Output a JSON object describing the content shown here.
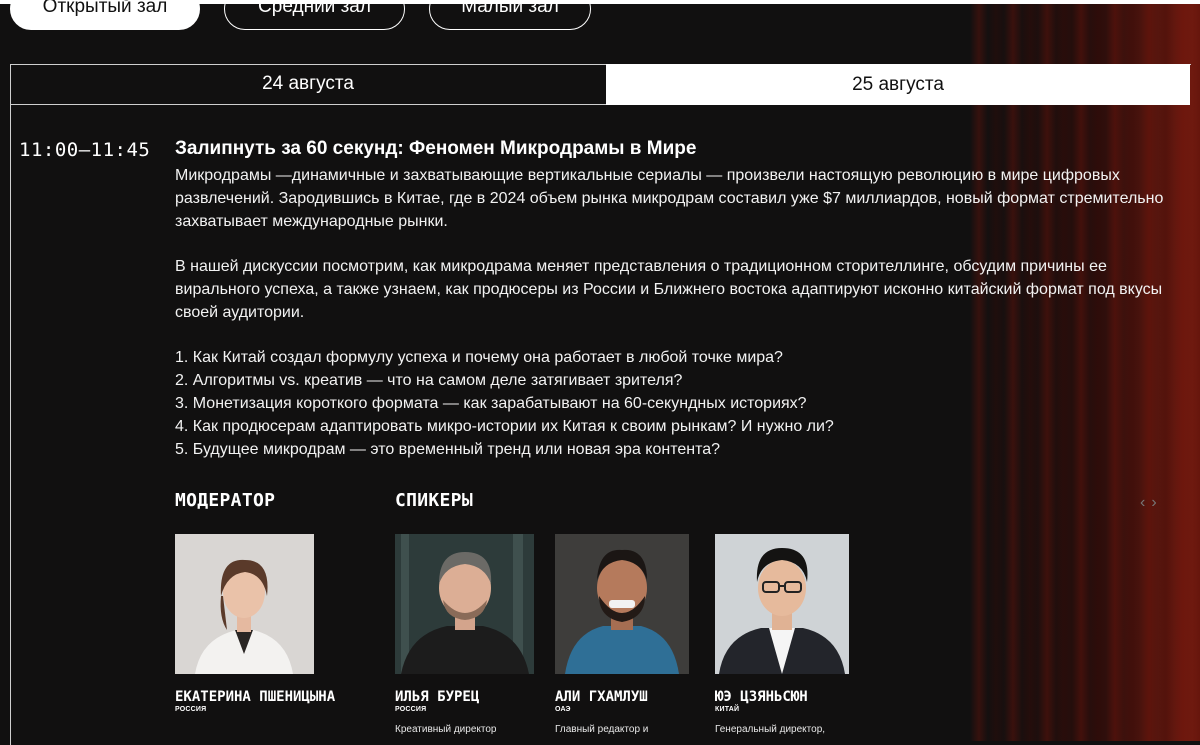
{
  "halls": [
    {
      "label": "Открытый зал",
      "active": true
    },
    {
      "label": "Средний зал",
      "active": false
    },
    {
      "label": "Малый зал",
      "active": false
    }
  ],
  "days": [
    {
      "label": "24 августа",
      "active": false
    },
    {
      "label": "25 августа",
      "active": true
    }
  ],
  "session": {
    "time": "11:00–11:45",
    "title": "Залипнуть за 60 секунд: Феномен Микродрамы в Мире",
    "paragraph1": "Микродрамы —динамичные и захватывающие вертикальные сериалы — произвели настоящую революцию в мире цифровых развлечений. Зародившись в Китае, где в 2024 объем рынка микродрам составил уже $7 миллиардов, новый формат стремительно захватывает международные рынки.",
    "paragraph2": "В нашей дискуссии посмотрим, как микродрама меняет представления о традиционном сторителлинге, обсудим причины ее вирального успеха, а также узнаем, как продюсеры из России и Ближнего востока адаптируют исконно китайский формат под вкусы своей аудитории.",
    "questions": [
      "1. Как Китай создал формулу успеха и почему она работает в любой точке мира?",
      "2. Алгоритмы vs. креатив — что на самом деле затягивает зрителя?",
      "3. Монетизация короткого формата — как зарабатывают на 60-секундных историях?",
      "4. Как продюсерам адаптировать микро-истории их Китая к своим рынкам? И нужно ли?",
      "5. Будущее микродрам — это временный тренд или новая эра контента?"
    ]
  },
  "labels": {
    "moderator": "МОДЕРАТОР",
    "speakers": "СПИКЕРЫ",
    "prev": "‹",
    "next": "›"
  },
  "moderator": {
    "name": "ЕКАТЕРИНА ПШЕНИЦЫНА",
    "country": "РОССИЯ",
    "role": ""
  },
  "speakers": [
    {
      "name": "ИЛЬЯ БУРЕЦ",
      "country": "РОССИЯ",
      "role": "Креативный директор"
    },
    {
      "name": "АЛИ ГХАМЛУШ",
      "country": "ОАЭ",
      "role": "Главный редактор и"
    },
    {
      "name": "ЮЭ ЦЗЯНЬСЮН",
      "country": "КИТАЙ",
      "role": "Генеральный директор,"
    }
  ]
}
